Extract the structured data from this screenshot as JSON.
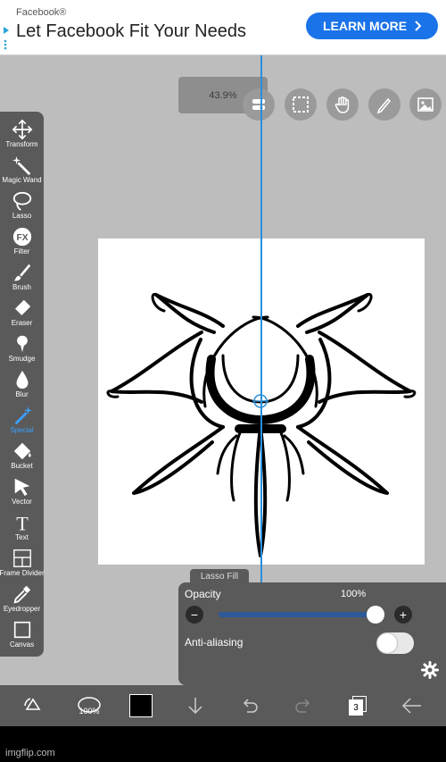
{
  "ad": {
    "source": "Facebook®",
    "headline": "Let Facebook Fit Your Needs",
    "cta": "LEARN MORE"
  },
  "zoom": "43.9%",
  "tools": [
    {
      "label": "Transform",
      "icon": "move-arrows-icon"
    },
    {
      "label": "Magic Wand",
      "icon": "magic-wand-icon"
    },
    {
      "label": "Lasso",
      "icon": "lasso-icon"
    },
    {
      "label": "Filter",
      "icon": "fx-icon"
    },
    {
      "label": "Brush",
      "icon": "brush-icon"
    },
    {
      "label": "Eraser",
      "icon": "eraser-icon"
    },
    {
      "label": "Smudge",
      "icon": "smudge-icon"
    },
    {
      "label": "Blur",
      "icon": "blur-drop-icon"
    },
    {
      "label": "Special",
      "icon": "special-wand-icon"
    },
    {
      "label": "Bucket",
      "icon": "bucket-icon"
    },
    {
      "label": "Vector",
      "icon": "vector-pointer-icon"
    },
    {
      "label": "Text",
      "icon": "text-icon"
    },
    {
      "label": "Frame Divider",
      "icon": "frame-divider-icon"
    },
    {
      "label": "Eyedropper",
      "icon": "eyedropper-icon"
    },
    {
      "label": "Canvas",
      "icon": "canvas-icon"
    }
  ],
  "active_tool": "Special",
  "lasso_fill": {
    "tab": "Lasso Fill",
    "opacity_label": "Opacity",
    "opacity_value": "100%",
    "opacity": 1.0,
    "antialias_label": "Anti-aliasing",
    "antialias_on": false
  },
  "bottom": {
    "brush_size": "100%",
    "layers_count": "3"
  },
  "footer": "imgflip.com",
  "colors": {
    "accent": "#2a8fd8",
    "panel": "#5a5a5a",
    "cta": "#1a73e8",
    "slider": "#2d5a98"
  }
}
